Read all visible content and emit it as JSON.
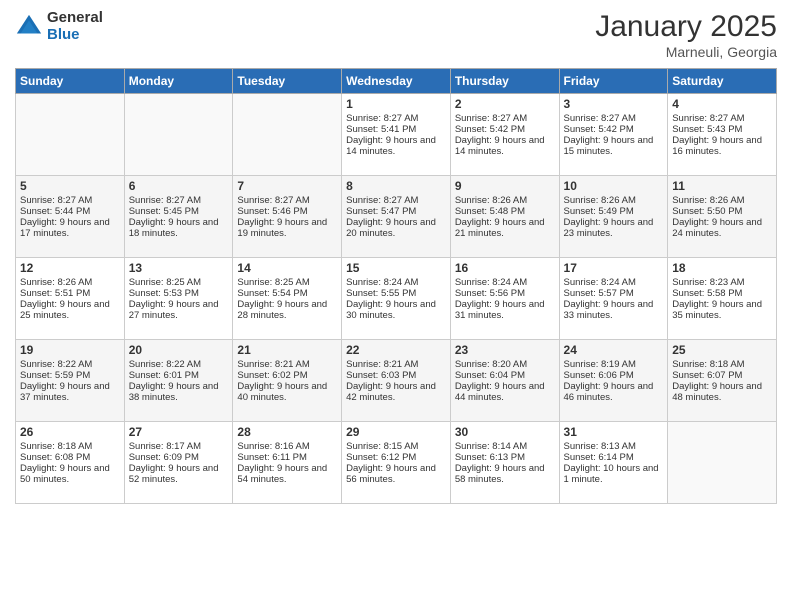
{
  "header": {
    "logo_general": "General",
    "logo_blue": "Blue",
    "month_title": "January 2025",
    "location": "Marneuli, Georgia"
  },
  "weekdays": [
    "Sunday",
    "Monday",
    "Tuesday",
    "Wednesday",
    "Thursday",
    "Friday",
    "Saturday"
  ],
  "weeks": [
    [
      {
        "day": "",
        "sunrise": "",
        "sunset": "",
        "daylight": ""
      },
      {
        "day": "",
        "sunrise": "",
        "sunset": "",
        "daylight": ""
      },
      {
        "day": "",
        "sunrise": "",
        "sunset": "",
        "daylight": ""
      },
      {
        "day": "1",
        "sunrise": "Sunrise: 8:27 AM",
        "sunset": "Sunset: 5:41 PM",
        "daylight": "Daylight: 9 hours and 14 minutes."
      },
      {
        "day": "2",
        "sunrise": "Sunrise: 8:27 AM",
        "sunset": "Sunset: 5:42 PM",
        "daylight": "Daylight: 9 hours and 14 minutes."
      },
      {
        "day": "3",
        "sunrise": "Sunrise: 8:27 AM",
        "sunset": "Sunset: 5:42 PM",
        "daylight": "Daylight: 9 hours and 15 minutes."
      },
      {
        "day": "4",
        "sunrise": "Sunrise: 8:27 AM",
        "sunset": "Sunset: 5:43 PM",
        "daylight": "Daylight: 9 hours and 16 minutes."
      }
    ],
    [
      {
        "day": "5",
        "sunrise": "Sunrise: 8:27 AM",
        "sunset": "Sunset: 5:44 PM",
        "daylight": "Daylight: 9 hours and 17 minutes."
      },
      {
        "day": "6",
        "sunrise": "Sunrise: 8:27 AM",
        "sunset": "Sunset: 5:45 PM",
        "daylight": "Daylight: 9 hours and 18 minutes."
      },
      {
        "day": "7",
        "sunrise": "Sunrise: 8:27 AM",
        "sunset": "Sunset: 5:46 PM",
        "daylight": "Daylight: 9 hours and 19 minutes."
      },
      {
        "day": "8",
        "sunrise": "Sunrise: 8:27 AM",
        "sunset": "Sunset: 5:47 PM",
        "daylight": "Daylight: 9 hours and 20 minutes."
      },
      {
        "day": "9",
        "sunrise": "Sunrise: 8:26 AM",
        "sunset": "Sunset: 5:48 PM",
        "daylight": "Daylight: 9 hours and 21 minutes."
      },
      {
        "day": "10",
        "sunrise": "Sunrise: 8:26 AM",
        "sunset": "Sunset: 5:49 PM",
        "daylight": "Daylight: 9 hours and 23 minutes."
      },
      {
        "day": "11",
        "sunrise": "Sunrise: 8:26 AM",
        "sunset": "Sunset: 5:50 PM",
        "daylight": "Daylight: 9 hours and 24 minutes."
      }
    ],
    [
      {
        "day": "12",
        "sunrise": "Sunrise: 8:26 AM",
        "sunset": "Sunset: 5:51 PM",
        "daylight": "Daylight: 9 hours and 25 minutes."
      },
      {
        "day": "13",
        "sunrise": "Sunrise: 8:25 AM",
        "sunset": "Sunset: 5:53 PM",
        "daylight": "Daylight: 9 hours and 27 minutes."
      },
      {
        "day": "14",
        "sunrise": "Sunrise: 8:25 AM",
        "sunset": "Sunset: 5:54 PM",
        "daylight": "Daylight: 9 hours and 28 minutes."
      },
      {
        "day": "15",
        "sunrise": "Sunrise: 8:24 AM",
        "sunset": "Sunset: 5:55 PM",
        "daylight": "Daylight: 9 hours and 30 minutes."
      },
      {
        "day": "16",
        "sunrise": "Sunrise: 8:24 AM",
        "sunset": "Sunset: 5:56 PM",
        "daylight": "Daylight: 9 hours and 31 minutes."
      },
      {
        "day": "17",
        "sunrise": "Sunrise: 8:24 AM",
        "sunset": "Sunset: 5:57 PM",
        "daylight": "Daylight: 9 hours and 33 minutes."
      },
      {
        "day": "18",
        "sunrise": "Sunrise: 8:23 AM",
        "sunset": "Sunset: 5:58 PM",
        "daylight": "Daylight: 9 hours and 35 minutes."
      }
    ],
    [
      {
        "day": "19",
        "sunrise": "Sunrise: 8:22 AM",
        "sunset": "Sunset: 5:59 PM",
        "daylight": "Daylight: 9 hours and 37 minutes."
      },
      {
        "day": "20",
        "sunrise": "Sunrise: 8:22 AM",
        "sunset": "Sunset: 6:01 PM",
        "daylight": "Daylight: 9 hours and 38 minutes."
      },
      {
        "day": "21",
        "sunrise": "Sunrise: 8:21 AM",
        "sunset": "Sunset: 6:02 PM",
        "daylight": "Daylight: 9 hours and 40 minutes."
      },
      {
        "day": "22",
        "sunrise": "Sunrise: 8:21 AM",
        "sunset": "Sunset: 6:03 PM",
        "daylight": "Daylight: 9 hours and 42 minutes."
      },
      {
        "day": "23",
        "sunrise": "Sunrise: 8:20 AM",
        "sunset": "Sunset: 6:04 PM",
        "daylight": "Daylight: 9 hours and 44 minutes."
      },
      {
        "day": "24",
        "sunrise": "Sunrise: 8:19 AM",
        "sunset": "Sunset: 6:06 PM",
        "daylight": "Daylight: 9 hours and 46 minutes."
      },
      {
        "day": "25",
        "sunrise": "Sunrise: 8:18 AM",
        "sunset": "Sunset: 6:07 PM",
        "daylight": "Daylight: 9 hours and 48 minutes."
      }
    ],
    [
      {
        "day": "26",
        "sunrise": "Sunrise: 8:18 AM",
        "sunset": "Sunset: 6:08 PM",
        "daylight": "Daylight: 9 hours and 50 minutes."
      },
      {
        "day": "27",
        "sunrise": "Sunrise: 8:17 AM",
        "sunset": "Sunset: 6:09 PM",
        "daylight": "Daylight: 9 hours and 52 minutes."
      },
      {
        "day": "28",
        "sunrise": "Sunrise: 8:16 AM",
        "sunset": "Sunset: 6:11 PM",
        "daylight": "Daylight: 9 hours and 54 minutes."
      },
      {
        "day": "29",
        "sunrise": "Sunrise: 8:15 AM",
        "sunset": "Sunset: 6:12 PM",
        "daylight": "Daylight: 9 hours and 56 minutes."
      },
      {
        "day": "30",
        "sunrise": "Sunrise: 8:14 AM",
        "sunset": "Sunset: 6:13 PM",
        "daylight": "Daylight: 9 hours and 58 minutes."
      },
      {
        "day": "31",
        "sunrise": "Sunrise: 8:13 AM",
        "sunset": "Sunset: 6:14 PM",
        "daylight": "Daylight: 10 hours and 1 minute."
      },
      {
        "day": "",
        "sunrise": "",
        "sunset": "",
        "daylight": ""
      }
    ]
  ]
}
